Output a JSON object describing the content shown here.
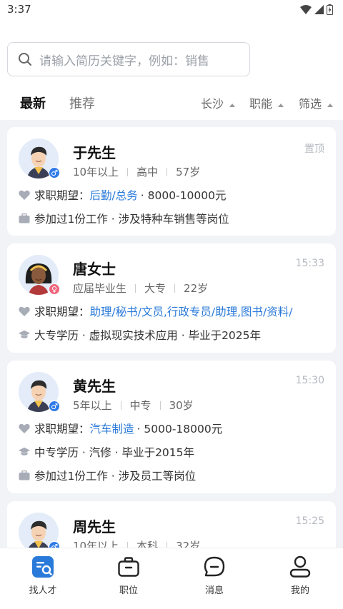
{
  "status": {
    "time": "3:37"
  },
  "search": {
    "placeholder": "请输入简历关键字，例如：销售"
  },
  "tabs": {
    "latest": "最新",
    "recommend": "推荐"
  },
  "filters": {
    "city": "长沙",
    "function": "职能",
    "filter": "筛选"
  },
  "cards": [
    {
      "name": "于先生",
      "time": "置顶",
      "gender": "male",
      "meta": [
        "10年以上",
        "高中",
        "57岁"
      ],
      "expect_label": "求职期望：",
      "expect_job": "后勤/总务",
      "expect_salary": "· 8000-10000元",
      "line2": "参加过1份工作 · 涉及特种车销售等岗位"
    },
    {
      "name": "唐女士",
      "time": "15:33",
      "gender": "female",
      "meta": [
        "应届毕业生",
        "大专",
        "22岁"
      ],
      "expect_label": "求职期望：",
      "expect_job": "助理/秘书/文员,行政专员/助理,图书/资料/",
      "line2": "大专学历 · 虚拟现实技术应用 · 毕业于2025年"
    },
    {
      "name": "黄先生",
      "time": "15:30",
      "gender": "male",
      "meta": [
        "5年以上",
        "中专",
        "30岁"
      ],
      "expect_label": "求职期望：",
      "expect_job": "汽车制造",
      "expect_salary": "· 5000-18000元",
      "line2": "中专学历 · 汽修 · 毕业于2015年",
      "line3": "参加过1份工作 · 涉及员工等岗位"
    },
    {
      "name": "周先生",
      "time": "15:25",
      "gender": "male",
      "meta": [
        "10年以上",
        "本科",
        "32岁"
      ]
    }
  ],
  "nav": {
    "talent": "找人才",
    "jobs": "职位",
    "messages": "消息",
    "mine": "我的"
  },
  "colors": {
    "accent": "#2a7ad9",
    "male": "#2f7be8",
    "female": "#f0647c"
  }
}
